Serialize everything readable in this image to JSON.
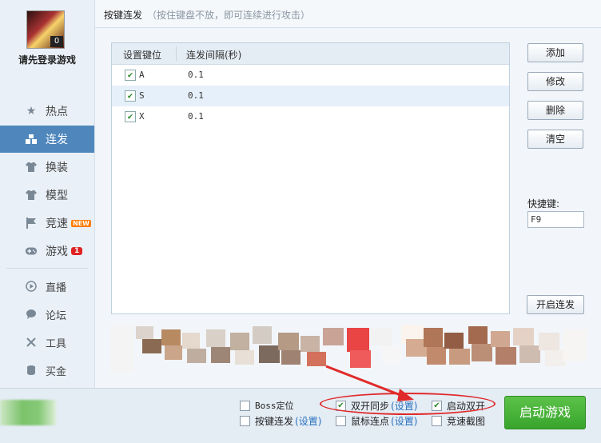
{
  "sidebar": {
    "avatar_badge": "0",
    "login_text": "请先登录游戏",
    "items": [
      {
        "label": "热点",
        "icon": "star-icon"
      },
      {
        "label": "连发",
        "icon": "blocks-icon",
        "active": true
      },
      {
        "label": "换装",
        "icon": "shirt-icon"
      },
      {
        "label": "模型",
        "icon": "tshirt-icon"
      },
      {
        "label": "竞速",
        "icon": "flag-icon",
        "badge": "NEW"
      },
      {
        "label": "游戏",
        "icon": "gamepad-icon",
        "badge": "1"
      },
      {
        "label": "直播",
        "icon": "play-circle-icon"
      },
      {
        "label": "论坛",
        "icon": "chat-bubble-icon"
      },
      {
        "label": "工具",
        "icon": "tools-icon"
      },
      {
        "label": "买金",
        "icon": "coins-icon"
      }
    ]
  },
  "header": {
    "title": "按键连发",
    "hint": "（按住键盘不放，即可连续进行攻击）"
  },
  "table": {
    "columns": [
      "设置键位",
      "连发间隔(秒)"
    ],
    "rows": [
      {
        "checked": true,
        "key": "A",
        "interval": "0.1"
      },
      {
        "checked": true,
        "key": "S",
        "interval": "0.1"
      },
      {
        "checked": true,
        "key": "X",
        "interval": "0.1"
      }
    ]
  },
  "actions": {
    "add": "添加",
    "edit": "修改",
    "delete": "删除",
    "clear": "清空",
    "start_burst": "开启连发"
  },
  "hotkey": {
    "label": "快捷键:",
    "value": "F9"
  },
  "bottom": {
    "options": [
      {
        "label": "Boss定位",
        "checked": false
      },
      {
        "label": "按键连发",
        "checked": false,
        "link": "(设置)"
      },
      {
        "label": "双开同步",
        "checked": true,
        "link": "(设置)"
      },
      {
        "label": "鼠标连点",
        "checked": false,
        "link": "(设置)"
      },
      {
        "label": "启动双开",
        "checked": true
      },
      {
        "label": "竞速截图",
        "checked": false
      }
    ],
    "start_button": "启动游戏"
  },
  "colors": {
    "accent": "#4f87bd",
    "start_green": "#3eaa30",
    "annotation_red": "#e02a2a"
  }
}
